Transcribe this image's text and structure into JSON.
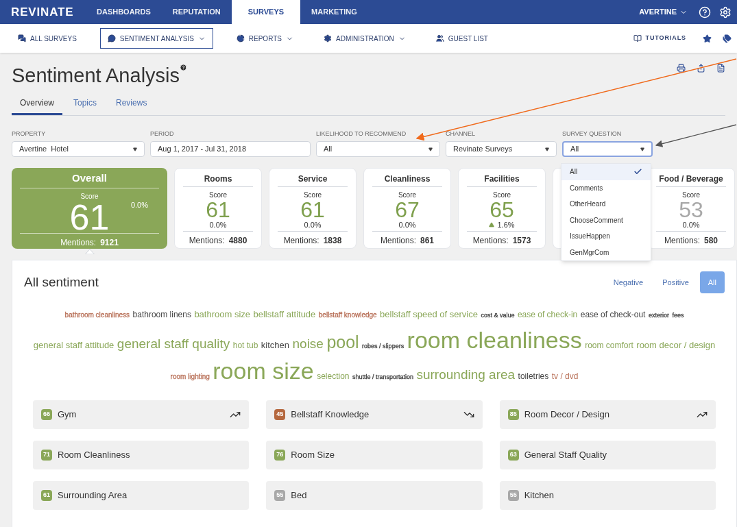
{
  "topnav": {
    "logo": "REVINATE",
    "items": [
      {
        "label": "DASHBOARDS",
        "selected": false
      },
      {
        "label": "REPUTATION",
        "selected": false
      },
      {
        "label": "SURVEYS",
        "selected": true
      },
      {
        "label": "MARKETING",
        "selected": false
      }
    ],
    "account": "AVERTINE"
  },
  "subnav": {
    "items": [
      {
        "label": "ALL SURVEYS",
        "dropdown": false,
        "selected": false
      },
      {
        "label": "SENTIMENT ANALYSIS",
        "dropdown": true,
        "selected": true
      },
      {
        "label": "REPORTS",
        "dropdown": true,
        "selected": false
      },
      {
        "label": "ADMINISTRATION",
        "dropdown": true,
        "selected": false
      },
      {
        "label": "GUEST LIST",
        "dropdown": false,
        "selected": false
      }
    ],
    "tutorials": "TUTORIALS"
  },
  "page": {
    "title": "Sentiment Analysis",
    "tabs": [
      {
        "label": "Overview",
        "selected": true
      },
      {
        "label": "Topics",
        "selected": false
      },
      {
        "label": "Reviews",
        "selected": false
      }
    ]
  },
  "filters": [
    {
      "label": "PROPERTY",
      "value": "Avertine  Hotel",
      "kind": "select",
      "focused": false
    },
    {
      "label": "PERIOD",
      "value": "Aug 1, 2017 - Jul 31, 2018",
      "kind": "text",
      "focused": false
    },
    {
      "label": "LIKELIHOOD TO RECOMMEND",
      "value": "All",
      "kind": "select",
      "focused": false
    },
    {
      "label": "CHANNEL",
      "value": "Revinate Surveys",
      "kind": "select",
      "focused": false
    },
    {
      "label": "SURVEY QUESTION",
      "value": "All",
      "kind": "select",
      "focused": true
    }
  ],
  "dropdown": {
    "options": [
      {
        "label": "All",
        "selected": true
      },
      {
        "label": "Comments",
        "selected": false
      },
      {
        "label": "OtherHeard",
        "selected": false
      },
      {
        "label": "ChooseComment",
        "selected": false
      },
      {
        "label": "IssueHappen",
        "selected": false
      },
      {
        "label": "GenMgrCom",
        "selected": false
      }
    ]
  },
  "cards": [
    {
      "kind": "overall",
      "title": "Overall",
      "score_label": "Score",
      "score": "61",
      "change": "0.0%",
      "rising": false,
      "mentions_label": "Mentions:",
      "mentions": "9121",
      "selected": true,
      "color": "#8aa758"
    },
    {
      "kind": "category",
      "title": "Rooms",
      "score_label": "Score",
      "score": "61",
      "change": "0.0%",
      "rising": false,
      "mentions_label": "Mentions:",
      "mentions": "4880",
      "selected": false,
      "color": "#7fa04e"
    },
    {
      "kind": "category",
      "title": "Service",
      "score_label": "Score",
      "score": "61",
      "change": "0.0%",
      "rising": false,
      "mentions_label": "Mentions:",
      "mentions": "1838",
      "selected": false,
      "color": "#7fa04e"
    },
    {
      "kind": "category",
      "title": "Cleanliness",
      "score_label": "Score",
      "score": "67",
      "change": "0.0%",
      "rising": false,
      "mentions_label": "Mentions:",
      "mentions": "861",
      "selected": false,
      "color": "#7fa04e"
    },
    {
      "kind": "category",
      "title": "Facilities",
      "score_label": "Score",
      "score": "65",
      "change": "1.6%",
      "rising": true,
      "mentions_label": "Mentions:",
      "mentions": "1573",
      "selected": false,
      "color": "#7fa04e"
    },
    {
      "kind": "covered"
    },
    {
      "kind": "category",
      "title": "Food / Beverage",
      "score_label": "Score",
      "score": "53",
      "change": "0.0%",
      "rising": false,
      "mentions_label": "Mentions:",
      "mentions": "580",
      "selected": false,
      "color": "#a8a8a8"
    }
  ],
  "sentiment": {
    "title": "All sentiment",
    "filters": [
      {
        "label": "Negative",
        "selected": false
      },
      {
        "label": "Positive",
        "selected": false
      },
      {
        "label": "All",
        "selected": true
      }
    ],
    "words": [
      {
        "text": "bathroom cleanliness",
        "kind": "tiny",
        "color": "#b9725a"
      },
      {
        "text": "bathroom linens",
        "kind": "small",
        "color": "#444444"
      },
      {
        "text": "bathroom size",
        "kind": "medium",
        "color": "#8aa758"
      },
      {
        "text": "bellstaff attitude",
        "kind": "medium",
        "color": "#8aa758"
      },
      {
        "text": "bellstaff knowledge",
        "kind": "tiny",
        "color": "#b9725a"
      },
      {
        "text": "bellstaff speed of service",
        "kind": "medium",
        "color": "#8aa758"
      },
      {
        "text": "cost & value",
        "kind": "minute",
        "color": "#444444"
      },
      {
        "text": "ease of check-in",
        "kind": "small",
        "color": "#8aa758"
      },
      {
        "text": "ease of check-out",
        "kind": "small",
        "color": "#444444"
      },
      {
        "text": "exterior",
        "kind": "minute",
        "color": "#444444"
      },
      {
        "text": "fees",
        "kind": "minute",
        "color": "#444444"
      },
      {
        "text": "general staff attitude",
        "kind": "medium",
        "color": "#8aa758"
      },
      {
        "text": "general staff quality",
        "kind": "large",
        "color": "#8aa758"
      },
      {
        "text": "hot tub",
        "kind": "small",
        "color": "#8aa758"
      },
      {
        "text": "kitchen",
        "kind": "medium",
        "color": "#444444"
      },
      {
        "text": "noise",
        "kind": "large",
        "color": "#8aa758"
      },
      {
        "text": "pool",
        "kind": "huge",
        "color": "#8aa758"
      },
      {
        "text": "robes / slippers",
        "kind": "minute",
        "color": "#444444"
      },
      {
        "text": "room cleanliness",
        "kind": "giant",
        "color": "#8aa758"
      },
      {
        "text": "room comfort",
        "kind": "small",
        "color": "#8aa758"
      },
      {
        "text": "room decor / design",
        "kind": "medium",
        "color": "#8aa758"
      },
      {
        "text": "room lighting",
        "kind": "tiny",
        "color": "#b9725a"
      },
      {
        "text": "room size",
        "kind": "giant",
        "color": "#8aa758"
      },
      {
        "text": "selection",
        "kind": "small",
        "color": "#8aa758"
      },
      {
        "text": "shuttle / transportation",
        "kind": "minute",
        "color": "#444444"
      },
      {
        "text": "surrounding area",
        "kind": "large",
        "color": "#8aa758"
      },
      {
        "text": "toiletries",
        "kind": "small",
        "color": "#444444"
      },
      {
        "text": "tv / dvd",
        "kind": "small",
        "color": "#b9725a"
      }
    ],
    "topics": [
      {
        "score": "66",
        "name": "Gym",
        "kind": "rising",
        "color": "#8aa758"
      },
      {
        "score": "45",
        "name": "Bellstaff Knowledge",
        "kind": "falling",
        "color": "#b5683f"
      },
      {
        "score": "85",
        "name": "Room Decor / Design",
        "kind": "rising",
        "color": "#8aa758"
      },
      {
        "score": "71",
        "name": "Room Cleanliness",
        "kind": "flat",
        "color": "#8aa758"
      },
      {
        "score": "76",
        "name": "Room Size",
        "kind": "flat",
        "color": "#8aa758"
      },
      {
        "score": "63",
        "name": "General Staff Quality",
        "kind": "flat",
        "color": "#8aa758"
      },
      {
        "score": "61",
        "name": "Surrounding Area",
        "kind": "flat",
        "color": "#8aa758"
      },
      {
        "score": "55",
        "name": "Bed",
        "kind": "flat",
        "color": "#a8a8a8"
      },
      {
        "score": "55",
        "name": "Kitchen",
        "kind": "flat",
        "color": "#a8a8a8"
      }
    ]
  }
}
